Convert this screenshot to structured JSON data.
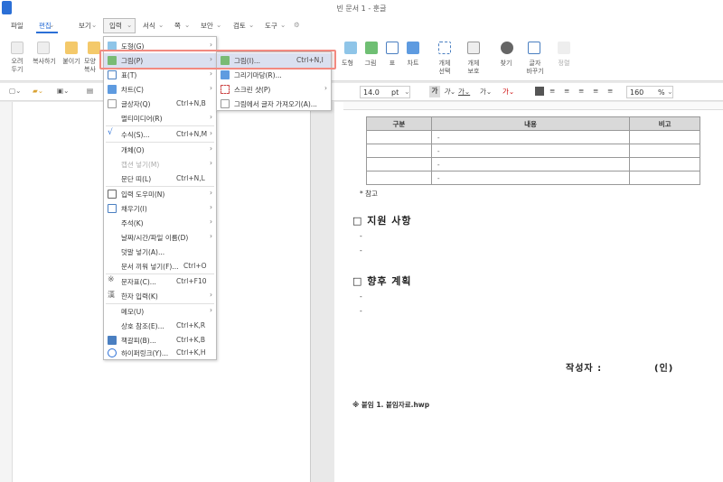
{
  "window": {
    "title": "빈 문서 1 - 훈글"
  },
  "menubar": {
    "items": [
      "파일",
      "편집",
      "보기",
      "입력",
      "서식",
      "쪽",
      "보안",
      "검토",
      "도구"
    ]
  },
  "ribbon": {
    "left": [
      {
        "label": "오려\n두기"
      },
      {
        "label": "복사하기"
      },
      {
        "label": "붙이기"
      },
      {
        "label": "모양\n복사"
      }
    ],
    "right": [
      {
        "label": "도형"
      },
      {
        "label": "그림"
      },
      {
        "label": "표"
      },
      {
        "label": "차트"
      },
      {
        "label": "개체\n선택"
      },
      {
        "label": "개체\n보호"
      },
      {
        "label": "찾기"
      },
      {
        "label": "글자\n바꾸기"
      },
      {
        "label": "정렬"
      }
    ]
  },
  "toolbar": {
    "font_size": "14.0",
    "font_unit": "pt",
    "zoom": "160",
    "zoom_unit": "%"
  },
  "input_menu": {
    "items": [
      {
        "label": "도형(G)",
        "shortcut": "",
        "arrow": true,
        "icon": "shape-icon"
      },
      {
        "label": "그림(P)",
        "shortcut": "",
        "arrow": true,
        "icon": "picture-icon"
      },
      {
        "label": "표(T)",
        "shortcut": "",
        "arrow": true,
        "icon": "table-icon"
      },
      {
        "label": "차트(C)",
        "shortcut": "",
        "arrow": true,
        "icon": "chart-icon"
      },
      {
        "label": "글상자(Q)",
        "shortcut": "Ctrl+N,B",
        "arrow": false,
        "icon": "textbox-icon"
      },
      {
        "label": "멀티미디어(R)",
        "shortcut": "",
        "arrow": true,
        "icon": ""
      },
      {
        "label": "수식(S)...",
        "shortcut": "Ctrl+N,M",
        "arrow": true,
        "icon": "formula-icon"
      },
      {
        "label": "개체(O)",
        "shortcut": "",
        "arrow": true,
        "icon": ""
      },
      {
        "label": "캡션 넣기(M)",
        "shortcut": "",
        "arrow": true,
        "icon": "",
        "disabled": true
      },
      {
        "label": "문단 띠(L)",
        "shortcut": "Ctrl+N,L",
        "arrow": false,
        "icon": ""
      },
      {
        "label": "입력 도우미(N)",
        "shortcut": "",
        "arrow": true,
        "icon": "helper-icon"
      },
      {
        "label": "채우기(I)",
        "shortcut": "",
        "arrow": true,
        "icon": "fill-icon"
      },
      {
        "label": "주석(K)",
        "shortcut": "",
        "arrow": true,
        "icon": ""
      },
      {
        "label": "날짜/시간/파일 이름(D)",
        "shortcut": "",
        "arrow": true,
        "icon": ""
      },
      {
        "label": "덧말 넣기(A)...",
        "shortcut": "",
        "arrow": false,
        "icon": ""
      },
      {
        "label": "문서 끼워 넣기(F)...",
        "shortcut": "Ctrl+O",
        "arrow": false,
        "icon": ""
      },
      {
        "label": "문자표(C)...",
        "shortcut": "Ctrl+F10",
        "arrow": false,
        "icon": "symbol-icon"
      },
      {
        "label": "한자 입력(K)",
        "shortcut": "",
        "arrow": true,
        "icon": "hanja-icon"
      },
      {
        "label": "메모(U)",
        "shortcut": "",
        "arrow": true,
        "icon": ""
      },
      {
        "label": "상호 참조(E)...",
        "shortcut": "Ctrl+K,R",
        "arrow": false,
        "icon": ""
      },
      {
        "label": "책갈피(B)...",
        "shortcut": "Ctrl+K,B",
        "arrow": false,
        "icon": "bookmark-icon"
      },
      {
        "label": "하이퍼링크(Y)...",
        "shortcut": "Ctrl+K,H",
        "arrow": false,
        "icon": "hyperlink-icon"
      }
    ]
  },
  "picture_submenu": {
    "items": [
      {
        "label": "그림(I)...",
        "shortcut": "Ctrl+N,I",
        "arrow": false
      },
      {
        "label": "그리기마당(R)...",
        "shortcut": "",
        "arrow": false
      },
      {
        "label": "스크린 샷(P)",
        "shortcut": "",
        "arrow": true
      },
      {
        "label": "그림에서 글자 가져오기(A)...",
        "shortcut": "",
        "arrow": false
      }
    ]
  },
  "document": {
    "table": {
      "headers": [
        "구분",
        "내용",
        "비고"
      ],
      "rows": [
        [
          "",
          "-",
          ""
        ],
        [
          "",
          "-",
          ""
        ],
        [
          "",
          "-",
          ""
        ],
        [
          "",
          "-",
          ""
        ]
      ]
    },
    "note": "* 참고",
    "section1": {
      "title": "□ 지원 사항",
      "lines": [
        "-",
        "-"
      ]
    },
    "section2": {
      "title": "□ 향후 계획",
      "lines": [
        "-",
        "-"
      ]
    },
    "author_label": "작성자 :",
    "seal": "(인)",
    "attachment": "※ 붙임 1. 붙임자료.hwp"
  }
}
